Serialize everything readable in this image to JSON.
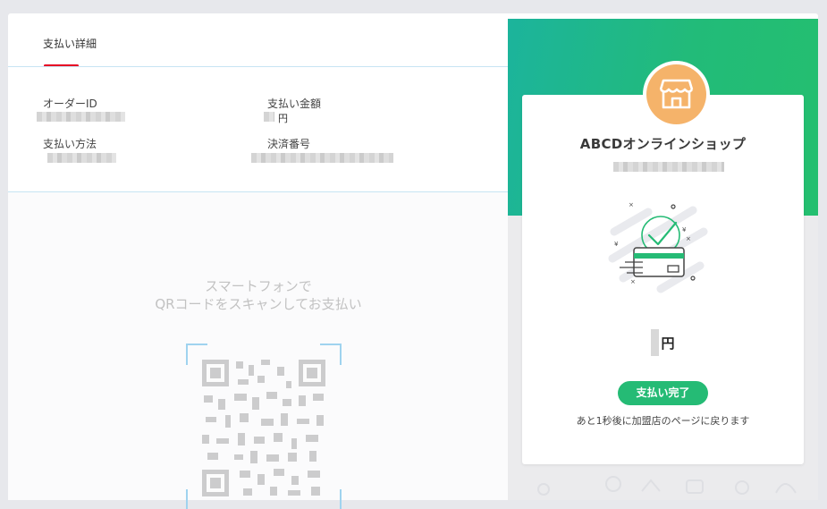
{
  "details": {
    "tab_label": "支払い詳細",
    "order_id_label": "オーダーID",
    "amount_label": "支払い金額",
    "amount_unit": "円",
    "method_label": "支払い方法",
    "settlement_label": "決済番号"
  },
  "scan": {
    "line1": "スマートフォンで",
    "line2": "QRコードをスキャンしてお支払い"
  },
  "merchant": {
    "name": "ABCDオンラインショップ",
    "amount_unit": "円",
    "status_button": "支払い完了",
    "redirect_message": "あと1秒後に加盟店のページに戻ります"
  },
  "colors": {
    "accent_red": "#e60023",
    "green": "#25bb75",
    "shop_icon_bg": "#f5b36a",
    "divider": "#c7e4f3"
  },
  "icons": [
    "shop-icon",
    "payment-complete-illustration",
    "qr-code"
  ]
}
